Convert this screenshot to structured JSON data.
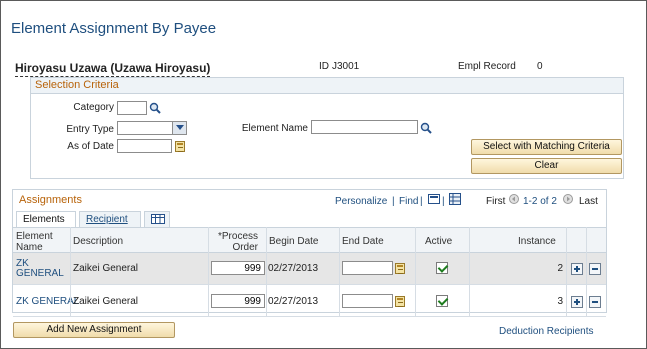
{
  "page_title": "Element Assignment By Payee",
  "employee": {
    "name": "Hiroyasu Uzawa (Uzawa Hiroyasu)",
    "id_label": "ID",
    "id_value": "J3001",
    "empl_record_label": "Empl Record",
    "empl_record_value": "0"
  },
  "selection": {
    "title": "Selection Criteria",
    "category_label": "Category",
    "category_value": "",
    "entry_type_label": "Entry Type",
    "entry_type_value": "",
    "as_of_date_label": "As of Date",
    "as_of_date_value": "",
    "element_name_label": "Element Name",
    "element_name_value": "",
    "select_button": "Select with Matching Criteria",
    "clear_button": "Clear"
  },
  "assignments": {
    "title": "Assignments",
    "personalize": "Personalize",
    "find": "Find",
    "first": "First",
    "range": "1-2 of 2",
    "last": "Last",
    "tabs": [
      "Elements",
      "Recipient"
    ],
    "columns": {
      "element_name": "Element Name",
      "description": "Description",
      "process_order": "*Process Order",
      "begin_date": "Begin Date",
      "end_date": "End Date",
      "active": "Active",
      "instance": "Instance"
    },
    "rows": [
      {
        "element_name": "ZK GENERAL",
        "description": "Zaikei General",
        "process_order": "999",
        "begin_date": "02/27/2013",
        "end_date": "",
        "active": true,
        "instance": "2"
      },
      {
        "element_name": "ZK GENERAL",
        "description": "Zaikei General",
        "process_order": "999",
        "begin_date": "02/27/2013",
        "end_date": "",
        "active": true,
        "instance": "3"
      }
    ]
  },
  "add_button": "Add New Assignment",
  "deduction_recipients": "Deduction Recipients",
  "colors": {
    "link": "#1f4f7f",
    "section_title": "#b8630a",
    "button": "#f0dcab"
  }
}
